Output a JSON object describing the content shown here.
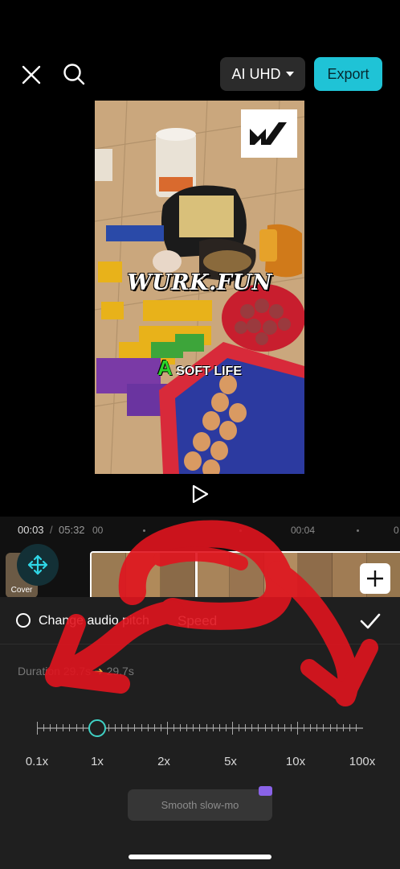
{
  "topbar": {
    "quality_label": "AI UHD",
    "export_label": "Export"
  },
  "preview": {
    "watermark_title": "WURK.FUN",
    "watermark_sub_letter": "A",
    "watermark_sub_text": "SOFT LIFE"
  },
  "timeline": {
    "current_time": "00:03",
    "separator": "/",
    "total_time": "05:32",
    "ruler_labels": [
      "00",
      "00:04",
      "0"
    ],
    "cover_label": "Cover"
  },
  "panel": {
    "pitch_label": "Change audio pitch",
    "title": "Speed",
    "duration_prefix": "Duration",
    "duration_from": "29.7s",
    "duration_to": "29.7s",
    "speed_values": [
      "0.1x",
      "1x",
      "2x",
      "5x",
      "10x",
      "100x"
    ],
    "selected_speed": "1x",
    "smooth_label": "Smooth slow-mo"
  },
  "colors": {
    "accent": "#1fc3d6",
    "knob": "#3fd0c4",
    "scribble": "#e0141e"
  }
}
